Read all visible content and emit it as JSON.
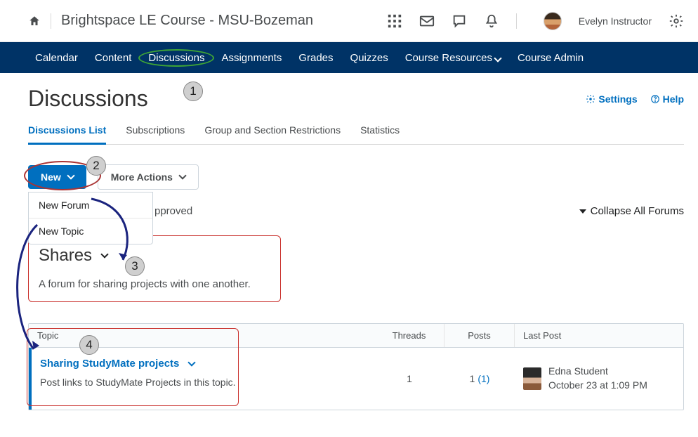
{
  "header": {
    "course_title": "Brightspace LE Course - MSU-Bozeman",
    "user_name": "Evelyn Instructor"
  },
  "nav": {
    "items": [
      {
        "label": "Calendar"
      },
      {
        "label": "Content"
      },
      {
        "label": "Discussions",
        "highlighted": true
      },
      {
        "label": "Assignments"
      },
      {
        "label": "Grades"
      },
      {
        "label": "Quizzes"
      },
      {
        "label": "Course Resources",
        "caret": true
      },
      {
        "label": "Course Admin"
      }
    ]
  },
  "page": {
    "title": "Discussions",
    "settings_label": "Settings",
    "help_label": "Help"
  },
  "subtabs": [
    {
      "label": "Discussions List",
      "active": true
    },
    {
      "label": "Subscriptions"
    },
    {
      "label": "Group and Section Restrictions"
    },
    {
      "label": "Statistics"
    }
  ],
  "toolbar": {
    "new_label": "New",
    "more_label": "More Actions",
    "dropdown": [
      {
        "label": "New Forum"
      },
      {
        "label": "New Topic"
      }
    ]
  },
  "filter": {
    "partial_label": "pproved",
    "collapse_label": "Collapse All Forums"
  },
  "forum": {
    "title": "Shares",
    "description": "A forum for sharing projects with one another."
  },
  "table": {
    "headers": {
      "topic": "Topic",
      "threads": "Threads",
      "posts": "Posts",
      "last_post": "Last Post"
    },
    "row": {
      "topic_name": "Sharing StudyMate projects",
      "topic_desc": "Post links to StudyMate Projects in this topic.",
      "threads": "1",
      "posts": "1",
      "posts_new": "(1)",
      "last_user": "Edna Student",
      "last_time": "October 23 at 1:09 PM"
    }
  },
  "badges": {
    "b1": "1",
    "b2": "2",
    "b3": "3",
    "b4": "4"
  }
}
